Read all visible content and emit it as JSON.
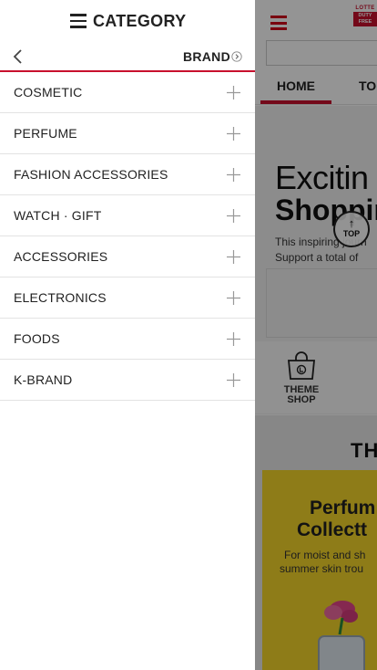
{
  "drawer": {
    "title": "CATEGORY",
    "brand_label": "BRAND",
    "categories": [
      {
        "label": "COSMETIC"
      },
      {
        "label": "PERFUME"
      },
      {
        "label": "FASHION ACCESSORIES"
      },
      {
        "label": "WATCH · GIFT"
      },
      {
        "label": "ACCESSORIES"
      },
      {
        "label": "ELECTRONICS"
      },
      {
        "label": "FOODS"
      },
      {
        "label": "K-BRAND"
      }
    ]
  },
  "background_page": {
    "logo": {
      "top": "LOTTE",
      "box_line1": "DUTY",
      "box_line2": "FREE"
    },
    "tabs": [
      {
        "label": "HOME"
      },
      {
        "label": "TO"
      }
    ],
    "hero": {
      "headline_1": "Excitin",
      "headline_2": "Shoppir",
      "text_1": "This inspiring journ",
      "text_2": "Support a total of"
    },
    "quick_menu": {
      "line1": "THEME",
      "line2": "SHOP"
    },
    "theme_section": {
      "title": "TH",
      "card_headline_1": "Perfum",
      "card_headline_2": "Collectt",
      "card_text_1": "For moist and sh",
      "card_text_2": "summer skin trou"
    },
    "top_button": {
      "label": "TOP"
    }
  },
  "colors": {
    "brand_red": "#c8102e",
    "overlay": "rgba(0,0,0,0.42)",
    "card_yellow": "#f5d62a"
  },
  "icons": [
    "menu-icon",
    "back-icon",
    "chevron-right-circle-icon",
    "plus-icon",
    "shopping-bag-icon",
    "arrow-up-icon"
  ]
}
